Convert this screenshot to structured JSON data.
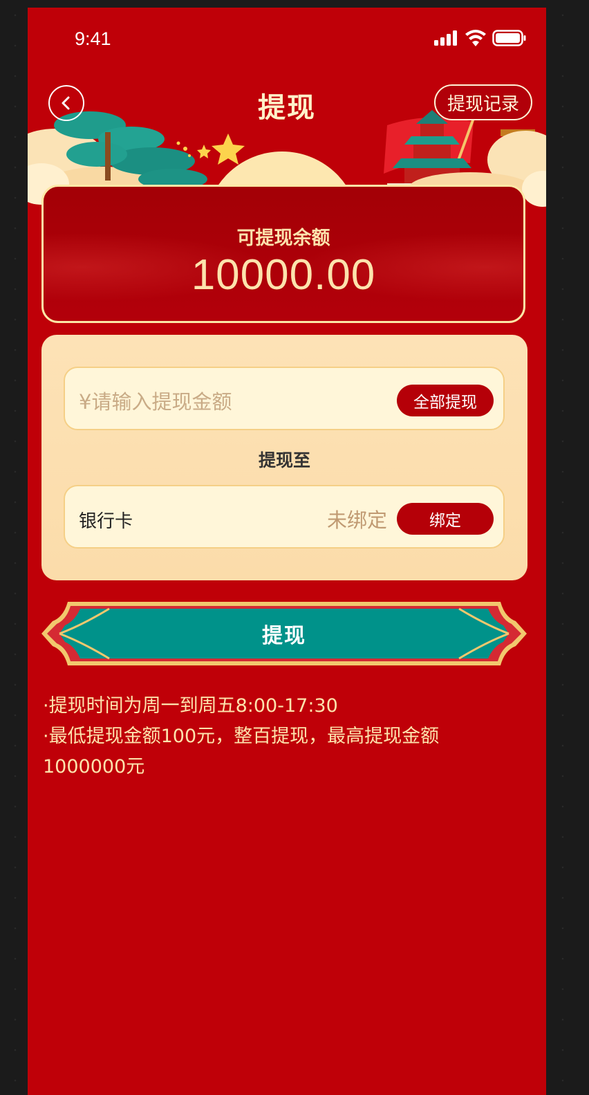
{
  "status_bar": {
    "time": "9:41",
    "icons": [
      "signal-icon",
      "wifi-icon",
      "battery-icon"
    ]
  },
  "nav": {
    "back_icon": "chevron-left-icon",
    "title": "提现",
    "records_label": "提现记录"
  },
  "balance": {
    "label": "可提现余额",
    "value": "10000.00"
  },
  "amount_field": {
    "placeholder": "¥请输入提现金额",
    "withdraw_all_label": "全部提现"
  },
  "destination": {
    "label": "提现至",
    "bank_label": "银行卡",
    "bank_status": "未绑定",
    "bind_label": "绑定"
  },
  "submit": {
    "label": "提现"
  },
  "notes": [
    "·提现时间为周一到周五8:00-17:30",
    "·最低提现金额100元，整百提现，最高提现金额1000000元"
  ],
  "colors": {
    "page_bg": "#bf0008",
    "accent_red": "#b50008",
    "teal": "#00928a",
    "gold_text": "#fde3ad",
    "card_bg": "#fde2b6",
    "field_bg": "#fff6d9"
  }
}
